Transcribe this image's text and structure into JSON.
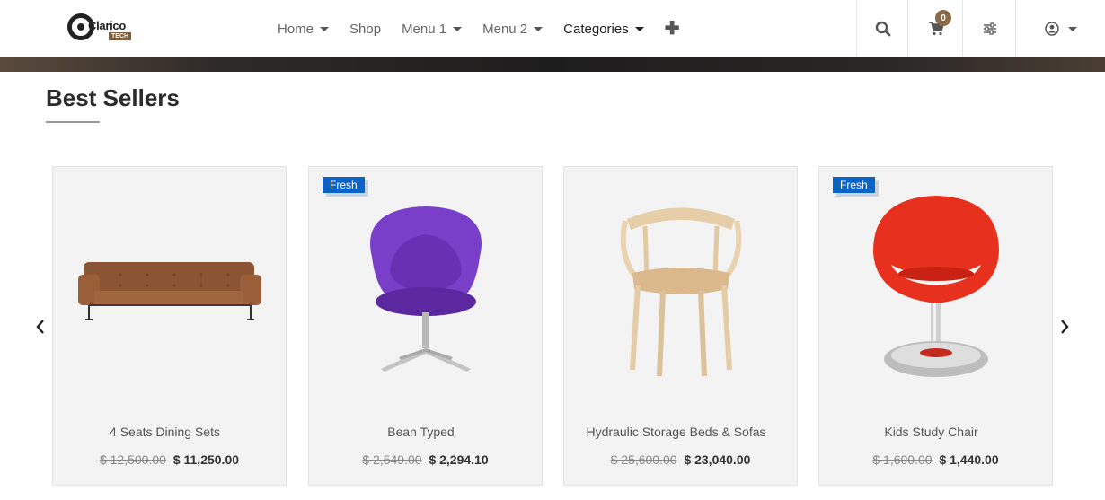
{
  "logo": {
    "text": "Clarico",
    "tag": "TECH"
  },
  "nav": {
    "items": [
      {
        "label": "Home",
        "dropdown": true
      },
      {
        "label": "Shop",
        "dropdown": false
      },
      {
        "label": "Menu 1",
        "dropdown": true
      },
      {
        "label": "Menu 2",
        "dropdown": true
      },
      {
        "label": "Categories",
        "dropdown": true
      }
    ]
  },
  "header": {
    "cart_count": "0"
  },
  "section": {
    "title": "Best Sellers"
  },
  "products": [
    {
      "name": "4 Seats Dining Sets",
      "old_price": "$ 12,500.00",
      "price": "$ 11,250.00",
      "badge": ""
    },
    {
      "name": "Bean Typed",
      "old_price": "$ 2,549.00",
      "price": "$ 2,294.10",
      "badge": "Fresh"
    },
    {
      "name": "Hydraulic Storage Beds & Sofas",
      "old_price": "$ 25,600.00",
      "price": "$ 23,040.00",
      "badge": ""
    },
    {
      "name": "Kids Study Chair",
      "old_price": "$ 1,600.00",
      "price": "$ 1,440.00",
      "badge": "Fresh"
    }
  ],
  "colors": {
    "badge": "#0a63c7",
    "accent": "#8a6a48"
  },
  "icons": [
    "search-icon",
    "cart-icon",
    "sliders-icon",
    "user-circle-icon",
    "plus-icon",
    "chevron-left-icon",
    "chevron-right-icon"
  ]
}
